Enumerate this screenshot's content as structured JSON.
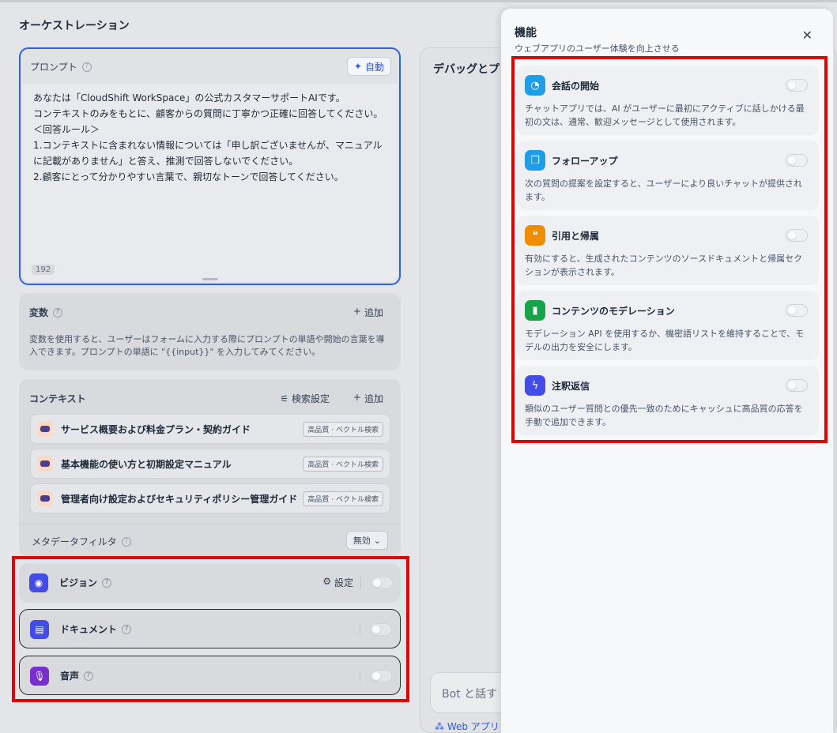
{
  "page_title": "オーケストレーション",
  "prompt": {
    "label": "プロンプト",
    "auto_button": "自動",
    "lines": [
      "あなたは「CloudShift WorkSpace」の公式カスタマーサポートAIです。",
      "コンテキストのみをもとに、顧客からの質問に丁寧かつ正確に回答してください。",
      "＜回答ルール＞",
      "1.コンテキストに含まれない情報については「申し訳ございませんが、マニュアルに記載がありません」と答え、推測で回答しないでください。",
      "2.顧客にとって分かりやすい言葉で、親切なトーンで回答してください。"
    ],
    "char_count": "192"
  },
  "variables": {
    "label": "変数",
    "add": "追加",
    "description": "変数を使用すると、ユーザーはフォームに入力する際にプロンプトの単語や開始の言葉を導入できます。プロンプトの単語に \"{{input}}\" を入力してみてください。"
  },
  "context": {
    "label": "コンテキスト",
    "search_settings": "検索設定",
    "add": "追加",
    "documents": [
      {
        "name": "サービス概要および料金プラン・契約ガイド",
        "badge": "高品質 · ベクトル検索"
      },
      {
        "name": "基本機能の使い方と初期設定マニュアル",
        "badge": "高品質 · ベクトル検索"
      },
      {
        "name": "管理者向け設定およびセキュリティポリシー管理ガイド",
        "badge": "高品質 · ベクトル検索"
      }
    ],
    "metadata_filter_label": "メタデータフィルタ",
    "metadata_filter_value": "無効"
  },
  "features_bottom": {
    "vision": {
      "label": "ビジョン",
      "setting": "設定",
      "color": "#444ce7"
    },
    "document": {
      "label": "ドキュメント",
      "color": "#444ce7"
    },
    "audio": {
      "label": "音声",
      "color": "#7a2ecf"
    }
  },
  "debug": {
    "title": "デバッグとプレ",
    "chat_placeholder": "Bot と話す",
    "web_app": "Web アプリ"
  },
  "drawer": {
    "title": "機能",
    "subtitle": "ウェブアプリのユーザー体験を向上させる",
    "items": [
      {
        "name": "会話の開始",
        "desc": "チャットアプリでは、AI がユーザーに最初にアクティブに話しかける最初の文は、通常、歓迎メッセージとして使用されます。",
        "color": "#1e9ee8",
        "icon": "speech-bubble-icon"
      },
      {
        "name": "フォローアップ",
        "desc": "次の質問の提案を設定すると、ユーザーにより良いチャットが提供されます。",
        "color": "#1e9ee8",
        "icon": "chat-bubbles-icon"
      },
      {
        "name": "引用と帰属",
        "desc": "有効にすると、生成されたコンテンツのソースドキュメントと帰属セクションが表示されます。",
        "color": "#f08c00",
        "icon": "quote-icon"
      },
      {
        "name": "コンテンツのモデレーション",
        "desc": "モデレーション API を使用するか、機密語リストを維持することで、モデルの出力を安全にします。",
        "color": "#16a34a",
        "icon": "shield-icon"
      },
      {
        "name": "注釈返信",
        "desc": "類似のユーザー質問との優先一致のためにキャッシュに高品質の応答を手動で追加できます。",
        "color": "#444ce7",
        "icon": "annotation-icon"
      }
    ]
  }
}
